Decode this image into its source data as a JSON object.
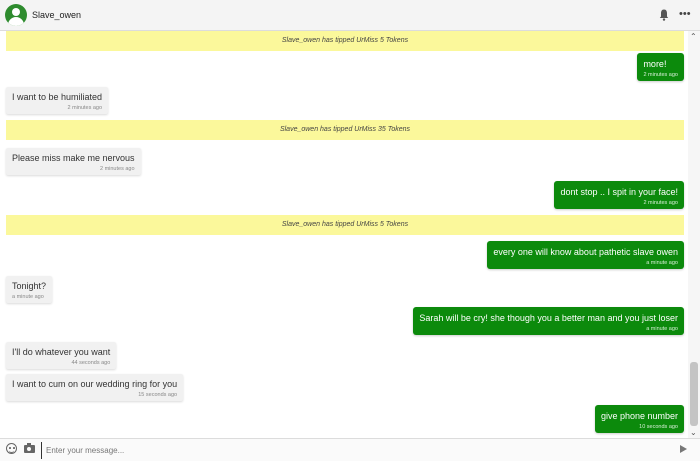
{
  "header": {
    "username": "Slave_owen",
    "more_glyph": "•••"
  },
  "scroll": {
    "up": "⌃",
    "down": "⌄"
  },
  "messages": {
    "tip1": "Slave_owen has tipped UrMiss 5 Tokens",
    "out1": {
      "text": "more!",
      "time": "2 minutes ago"
    },
    "in1": {
      "text": "I want to be humiliated",
      "time": "2 minutes ago"
    },
    "tip2": "Slave_owen has tipped UrMiss 35 Tokens",
    "in2": {
      "text": "Please miss make me nervous",
      "time": "2 minutes ago"
    },
    "out2": {
      "text": "dont stop .. I spit in your face!",
      "time": "2 minutes ago"
    },
    "tip3": "Slave_owen has tipped UrMiss 5 Tokens",
    "out3": {
      "text": "every one will know about pathetic slave owen",
      "time": "a minute ago"
    },
    "in3": {
      "text": "Tonight?",
      "time": "a minute ago"
    },
    "out4": {
      "text": "Sarah will be cry! she though you a better man and you just loser",
      "time": "a minute ago"
    },
    "in4": {
      "text": "I'll do whatever you want",
      "time": "44 seconds ago"
    },
    "in5": {
      "text": "I want to cum on our wedding ring for you",
      "time": "15 seconds ago"
    },
    "out5": {
      "text": "give phone number",
      "time": "10 seconds ago"
    }
  },
  "composer": {
    "placeholder": "Enter your message..."
  },
  "icons": {
    "avatar": "user-avatar-icon",
    "bell": "bell-icon",
    "more": "more-icon",
    "emoji": "emoji-icon",
    "camera": "camera-icon",
    "send": "send-icon"
  },
  "colors": {
    "outgoing": "#0c8a0c",
    "incoming": "#f1f1f1",
    "tip_banner": "#fbf89b",
    "avatar": "#2e8b2e"
  }
}
